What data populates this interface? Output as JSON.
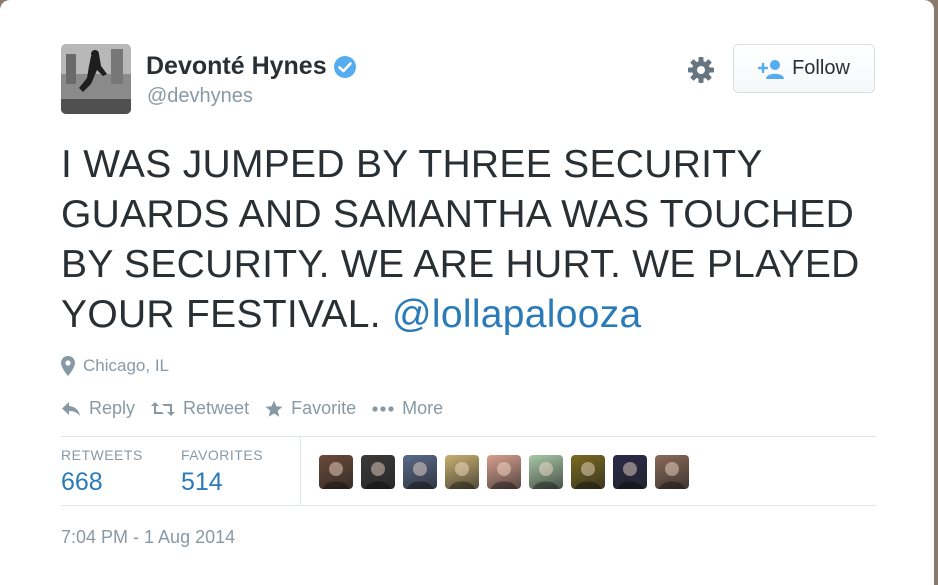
{
  "user": {
    "name": "Devonté Hynes",
    "handle": "@devhynes",
    "verified": true
  },
  "follow_label": "Follow",
  "tweet": {
    "text": "I WAS JUMPED BY THREE SECURITY GUARDS AND SAMANTHA WAS TOUCHED BY SECURITY. WE ARE HURT. WE PLAYED YOUR FESTIVAL.",
    "mention": "@lollapalooza"
  },
  "location": "Chicago, IL",
  "actions": {
    "reply": "Reply",
    "retweet": "Retweet",
    "favorite": "Favorite",
    "more": "More"
  },
  "stats": {
    "retweets_label": "RETWEETS",
    "retweets_value": "668",
    "favorites_label": "FAVORITES",
    "favorites_value": "514"
  },
  "favoriter_avatars": [
    {
      "name": "favoriter-avatar-1",
      "color": "#6b4a3a"
    },
    {
      "name": "favoriter-avatar-2",
      "color": "#3a3a3a"
    },
    {
      "name": "favoriter-avatar-3",
      "color": "#5a6a8a"
    },
    {
      "name": "favoriter-avatar-4",
      "color": "#c8b070"
    },
    {
      "name": "favoriter-avatar-5",
      "color": "#d8a090"
    },
    {
      "name": "favoriter-avatar-6",
      "color": "#a8c8a8"
    },
    {
      "name": "favoriter-avatar-7",
      "color": "#7a6a20"
    },
    {
      "name": "favoriter-avatar-8",
      "color": "#2a2a4a"
    },
    {
      "name": "favoriter-avatar-9",
      "color": "#8a6a5a"
    }
  ],
  "timestamp": "7:04 PM - 1 Aug 2014",
  "colors": {
    "link": "#2b7bb9",
    "muted": "#8899a6",
    "text": "#292f33",
    "verified": "#55acee"
  }
}
